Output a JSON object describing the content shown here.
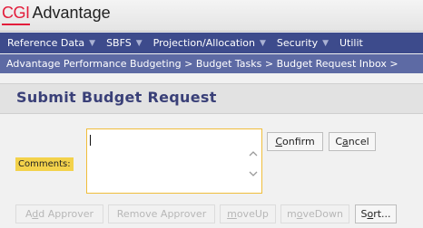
{
  "header": {
    "logo_brand": "CGI",
    "logo_app": "Advantage"
  },
  "nav": {
    "items": [
      {
        "label": "Reference Data",
        "dropdown": true
      },
      {
        "label": "SBFS",
        "dropdown": true
      },
      {
        "label": "Projection/Allocation",
        "dropdown": true
      },
      {
        "label": "Security",
        "dropdown": true
      },
      {
        "label": "Utilit",
        "dropdown": false
      }
    ]
  },
  "breadcrumb": "Advantage Performance Budgeting > Budget Tasks > Budget Request Inbox >",
  "page": {
    "title": "Submit Budget Request"
  },
  "form": {
    "comments_label": "Comments:",
    "comments_value": ""
  },
  "buttons": {
    "confirm": {
      "pre": "",
      "key": "C",
      "post": "onfirm"
    },
    "cancel": {
      "pre": "C",
      "key": "a",
      "post": "ncel"
    },
    "add_approver": {
      "pre": "A",
      "key": "d",
      "post": "d Approver"
    },
    "remove_approver": {
      "pre": "Remove Approver",
      "key": "",
      "post": ""
    },
    "move_up": {
      "pre": "",
      "key": "m",
      "post": "oveUp"
    },
    "move_down": {
      "pre": "m",
      "key": "o",
      "post": "veDown"
    },
    "sort": {
      "pre": "S",
      "key": "o",
      "post": "rt..."
    }
  },
  "colors": {
    "nav_bg": "#3d4b8c",
    "breadcrumb_bg": "#5d6aa4",
    "title": "#3a4078",
    "accent": "#f0bd3b",
    "brand_red": "#e31d3b"
  }
}
